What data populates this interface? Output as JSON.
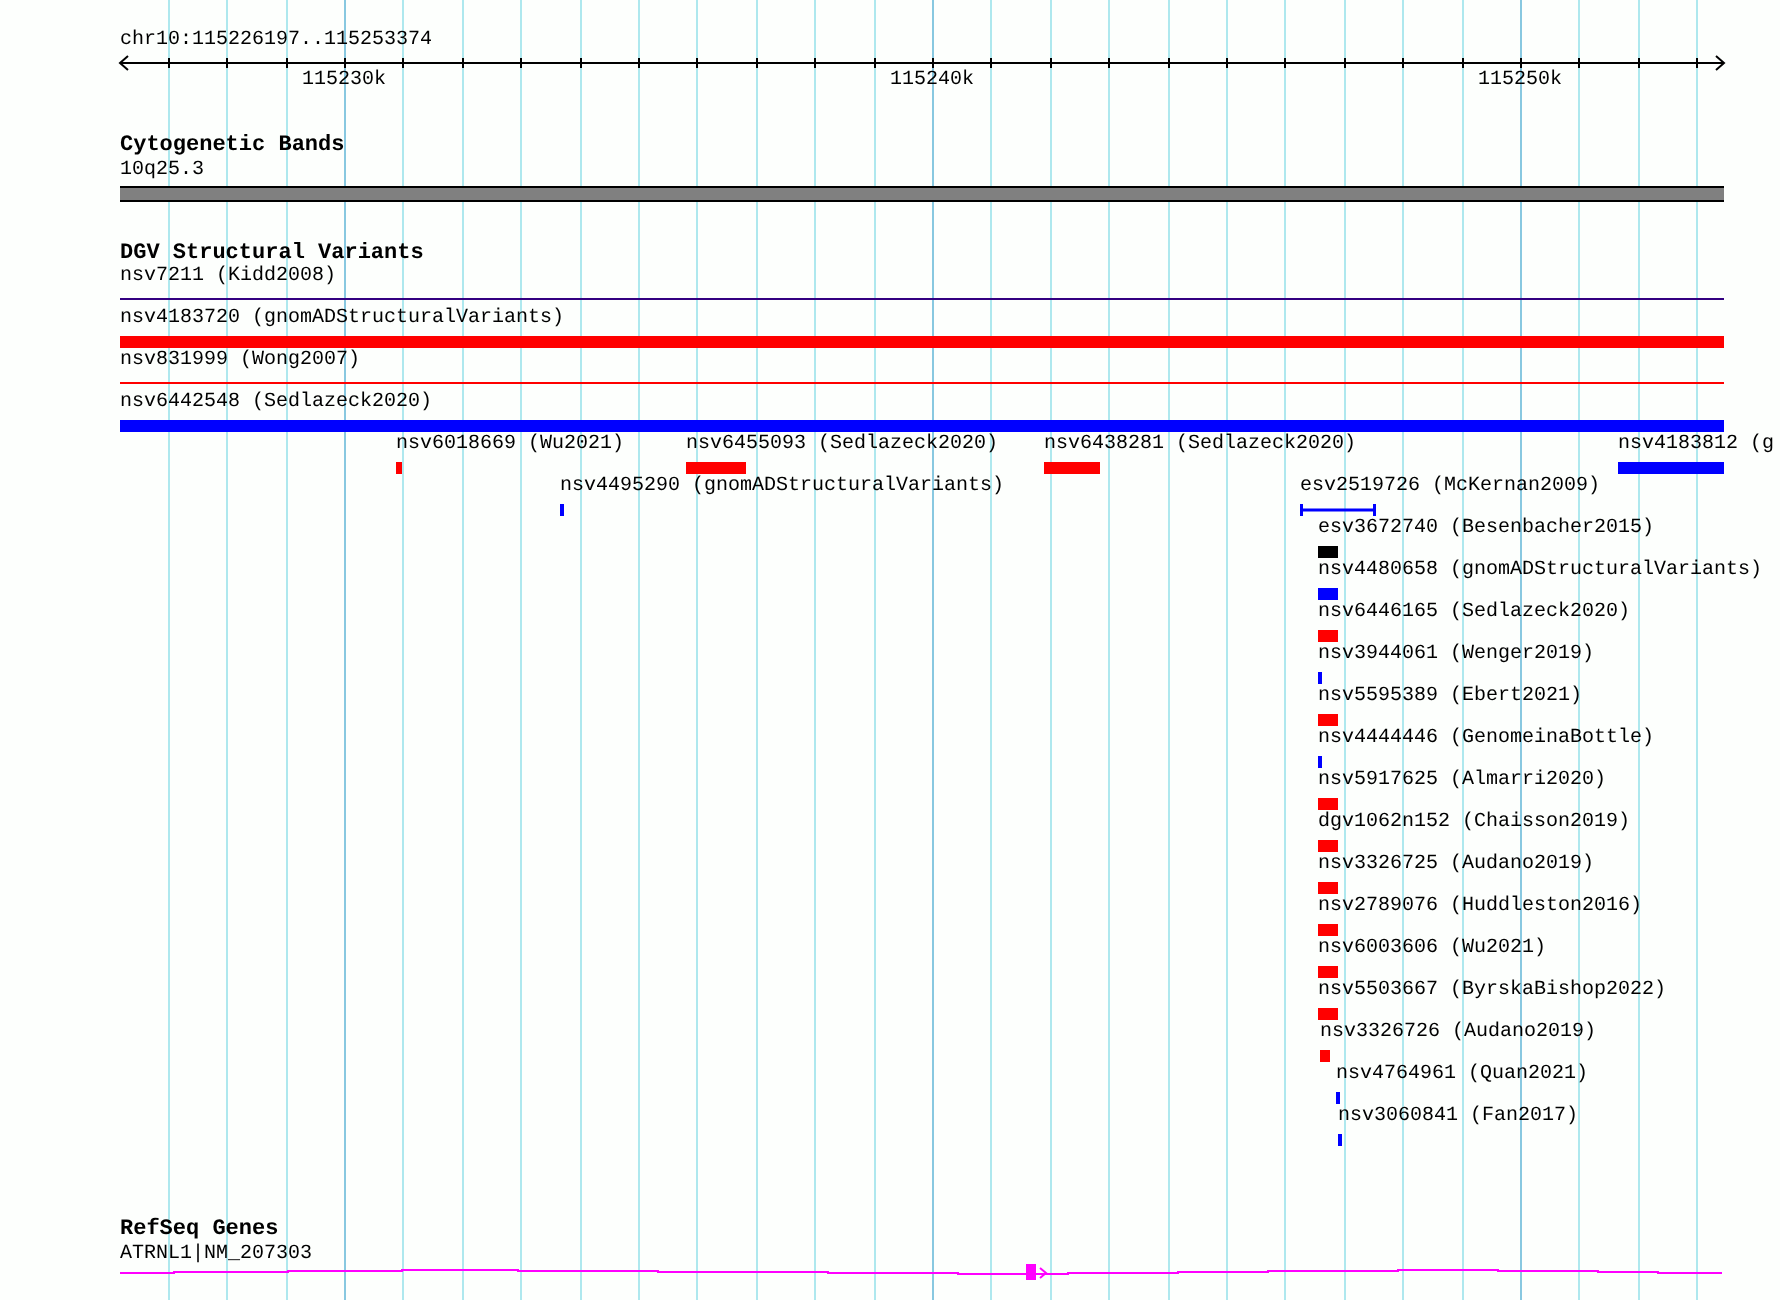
{
  "ruler": {
    "range": "chr10:115226197..115253374",
    "labels": [
      "115230k",
      "115240k",
      "115250k"
    ]
  },
  "cytogenetic_bands": {
    "title": "Cytogenetic Bands",
    "band_label": "10q25.3"
  },
  "dgv": {
    "title": "DGV Structural Variants",
    "features": [
      {
        "label": "nsv7211 (Kidd2008)",
        "kind": "line",
        "color": "#330080"
      },
      {
        "label": "nsv4183720 (gnomADStructuralVariants)",
        "kind": "bar",
        "color": "#ff0000"
      },
      {
        "label": "nsv831999 (Wong2007)",
        "kind": "line",
        "color": "#ff0000"
      },
      {
        "label": "nsv6442548 (Sedlazeck2020)",
        "kind": "bar",
        "color": "#0000ff"
      },
      {
        "label": "nsv6018669 (Wu2021)",
        "kind": "bar",
        "color": "#ff0000"
      },
      {
        "label": "nsv6455093 (Sedlazeck2020)",
        "kind": "bar",
        "color": "#ff0000"
      },
      {
        "label": "nsv6438281 (Sedlazeck2020)",
        "kind": "bar",
        "color": "#ff0000"
      },
      {
        "label": "nsv4183812 (g",
        "kind": "bar",
        "color": "#0000ff"
      },
      {
        "label": "nsv4495290 (gnomADStructuralVariants)",
        "kind": "bar",
        "color": "#0000ff"
      },
      {
        "label": "esv2519726 (McKernan2009)",
        "kind": "interval",
        "color": "#0000ff"
      },
      {
        "label": "esv3672740 (Besenbacher2015)",
        "kind": "bar",
        "color": "#000000"
      },
      {
        "label": "nsv4480658 (gnomADStructuralVariants)",
        "kind": "bar",
        "color": "#0000ff"
      },
      {
        "label": "nsv6446165 (Sedlazeck2020)",
        "kind": "bar",
        "color": "#ff0000"
      },
      {
        "label": "nsv3944061 (Wenger2019)",
        "kind": "bar",
        "color": "#0000ff"
      },
      {
        "label": "nsv5595389 (Ebert2021)",
        "kind": "bar",
        "color": "#ff0000"
      },
      {
        "label": "nsv4444446 (GenomeinaBottle)",
        "kind": "bar",
        "color": "#0000ff"
      },
      {
        "label": "nsv5917625 (Almarri2020)",
        "kind": "bar",
        "color": "#ff0000"
      },
      {
        "label": "dgv1062n152 (Chaisson2019)",
        "kind": "bar",
        "color": "#ff0000"
      },
      {
        "label": "nsv3326725 (Audano2019)",
        "kind": "bar",
        "color": "#ff0000"
      },
      {
        "label": "nsv2789076 (Huddleston2016)",
        "kind": "bar",
        "color": "#ff0000"
      },
      {
        "label": "nsv6003606 (Wu2021)",
        "kind": "bar",
        "color": "#ff0000"
      },
      {
        "label": "nsv5503667 (ByrskaBishop2022)",
        "kind": "bar",
        "color": "#ff0000"
      },
      {
        "label": "nsv3326726 (Audano2019)",
        "kind": "bar",
        "color": "#ff0000"
      },
      {
        "label": "nsv4764961 (Quan2021)",
        "kind": "bar",
        "color": "#0000ff"
      },
      {
        "label": "nsv3060841 (Fan2017)",
        "kind": "bar",
        "color": "#0000ff"
      }
    ]
  },
  "refseq_genes": {
    "title": "RefSeq Genes",
    "gene_label": "ATRNL1|NM_207303"
  }
}
